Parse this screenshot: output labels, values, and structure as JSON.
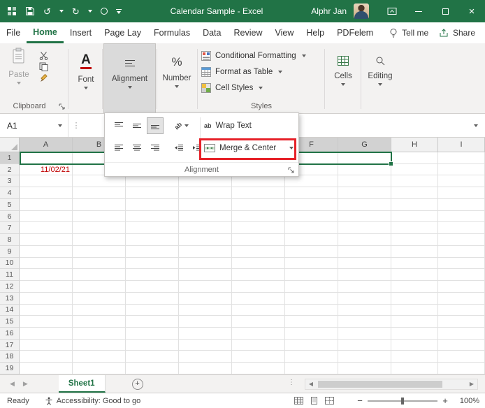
{
  "icons": {
    "undo": "↺",
    "redo": "↻",
    "close": "×",
    "dots_vertical": "⋮",
    "percent": "%",
    "font_a": "A",
    "ab": "ab",
    "left_tri": "◀",
    "right_tri": "▶",
    "minus": "−",
    "plus": "+",
    "zoom_minus": "−",
    "zoom_plus": "+"
  },
  "title_bar": {
    "title": "Calendar Sample  -  Excel",
    "user_name": "Alphr Jan"
  },
  "tabs": {
    "items": [
      {
        "label": "File"
      },
      {
        "label": "Home"
      },
      {
        "label": "Insert"
      },
      {
        "label": "Page Lay"
      },
      {
        "label": "Formulas"
      },
      {
        "label": "Data"
      },
      {
        "label": "Review"
      },
      {
        "label": "View"
      },
      {
        "label": "Help"
      },
      {
        "label": "PDFelem"
      }
    ],
    "tell_me": "Tell me",
    "share": "Share"
  },
  "ribbon": {
    "paste_label": "Paste",
    "clipboard_label": "Clipboard",
    "font_label": "Font",
    "alignment_label": "Alignment",
    "number_label": "Number",
    "conditional_formatting": "Conditional Formatting",
    "format_as_table": "Format as Table",
    "cell_styles": "Cell Styles",
    "styles_label": "Styles",
    "cells_label": "Cells",
    "editing_label": "Editing"
  },
  "flyout": {
    "wrap_text": "Wrap Text",
    "merge_center": "Merge & Center",
    "group_label": "Alignment"
  },
  "formula_bar": {
    "name_box": "A1",
    "formula": ""
  },
  "grid": {
    "columns": [
      "A",
      "B",
      "C",
      "D",
      "E",
      "F",
      "G",
      "H",
      "I"
    ],
    "selected_columns": [
      "A",
      "B",
      "C",
      "D",
      "E",
      "F",
      "G"
    ],
    "rows": [
      "1",
      "2",
      "3",
      "4",
      "5",
      "6",
      "7",
      "8",
      "9",
      "10",
      "11",
      "12",
      "13",
      "14",
      "15",
      "16",
      "17",
      "18",
      "19"
    ],
    "selected_rows": [
      "1"
    ],
    "cells": [
      {
        "ref": "A2",
        "value": "11/02/21",
        "color": "#c00000"
      }
    ]
  },
  "sheet_tabs": {
    "active_tab": "Sheet1"
  },
  "status_bar": {
    "ready": "Ready",
    "accessibility": "Accessibility: Good to go",
    "zoom": "100%"
  },
  "colors": {
    "excel_green": "#217346",
    "selection_green": "#217346",
    "annotation_red": "#e62129",
    "date_red": "#c00000"
  }
}
